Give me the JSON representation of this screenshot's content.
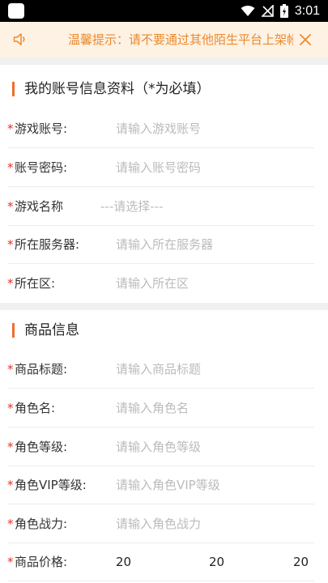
{
  "status_bar": {
    "time": "3:01"
  },
  "notice": {
    "text": "温馨提示：请不要通过其他陌生平台上架帐号，谨防上当受骗",
    "icons": {
      "left": "speaker-icon",
      "right": "close-icon"
    },
    "color": "#ec8a2c"
  },
  "account_section": {
    "title": "我的账号信息资料（*为必填）",
    "required_mark": "*",
    "fields": [
      {
        "label": "游戏账号:",
        "placeholder": "请输入游戏账号"
      },
      {
        "label": "账号密码:",
        "placeholder": "请输入账号密码"
      },
      {
        "label": "游戏名称",
        "placeholder": "---请选择---"
      },
      {
        "label": "所在服务器:",
        "placeholder": "请输入所在服务器"
      },
      {
        "label": "所在区:",
        "placeholder": "请输入所在区"
      }
    ]
  },
  "product_section": {
    "title": "商品信息",
    "required_mark": "*",
    "fields": [
      {
        "label": "商品标题:",
        "placeholder": "请输入商品标题"
      },
      {
        "label": "角色名:",
        "placeholder": "请输入角色名"
      },
      {
        "label": "角色等级:",
        "placeholder": "请输入角色等级"
      },
      {
        "label": "角色VIP等级:",
        "placeholder": "请输入角色VIP等级"
      },
      {
        "label": "角色战力:",
        "placeholder": "请输入角色战力"
      }
    ],
    "price": {
      "label": "商品价格:",
      "values": [
        "20",
        "20",
        "20"
      ]
    }
  },
  "colors": {
    "accent": "#ef6d2c",
    "required": "#e5312b",
    "placeholder": "#bbbbbb"
  }
}
